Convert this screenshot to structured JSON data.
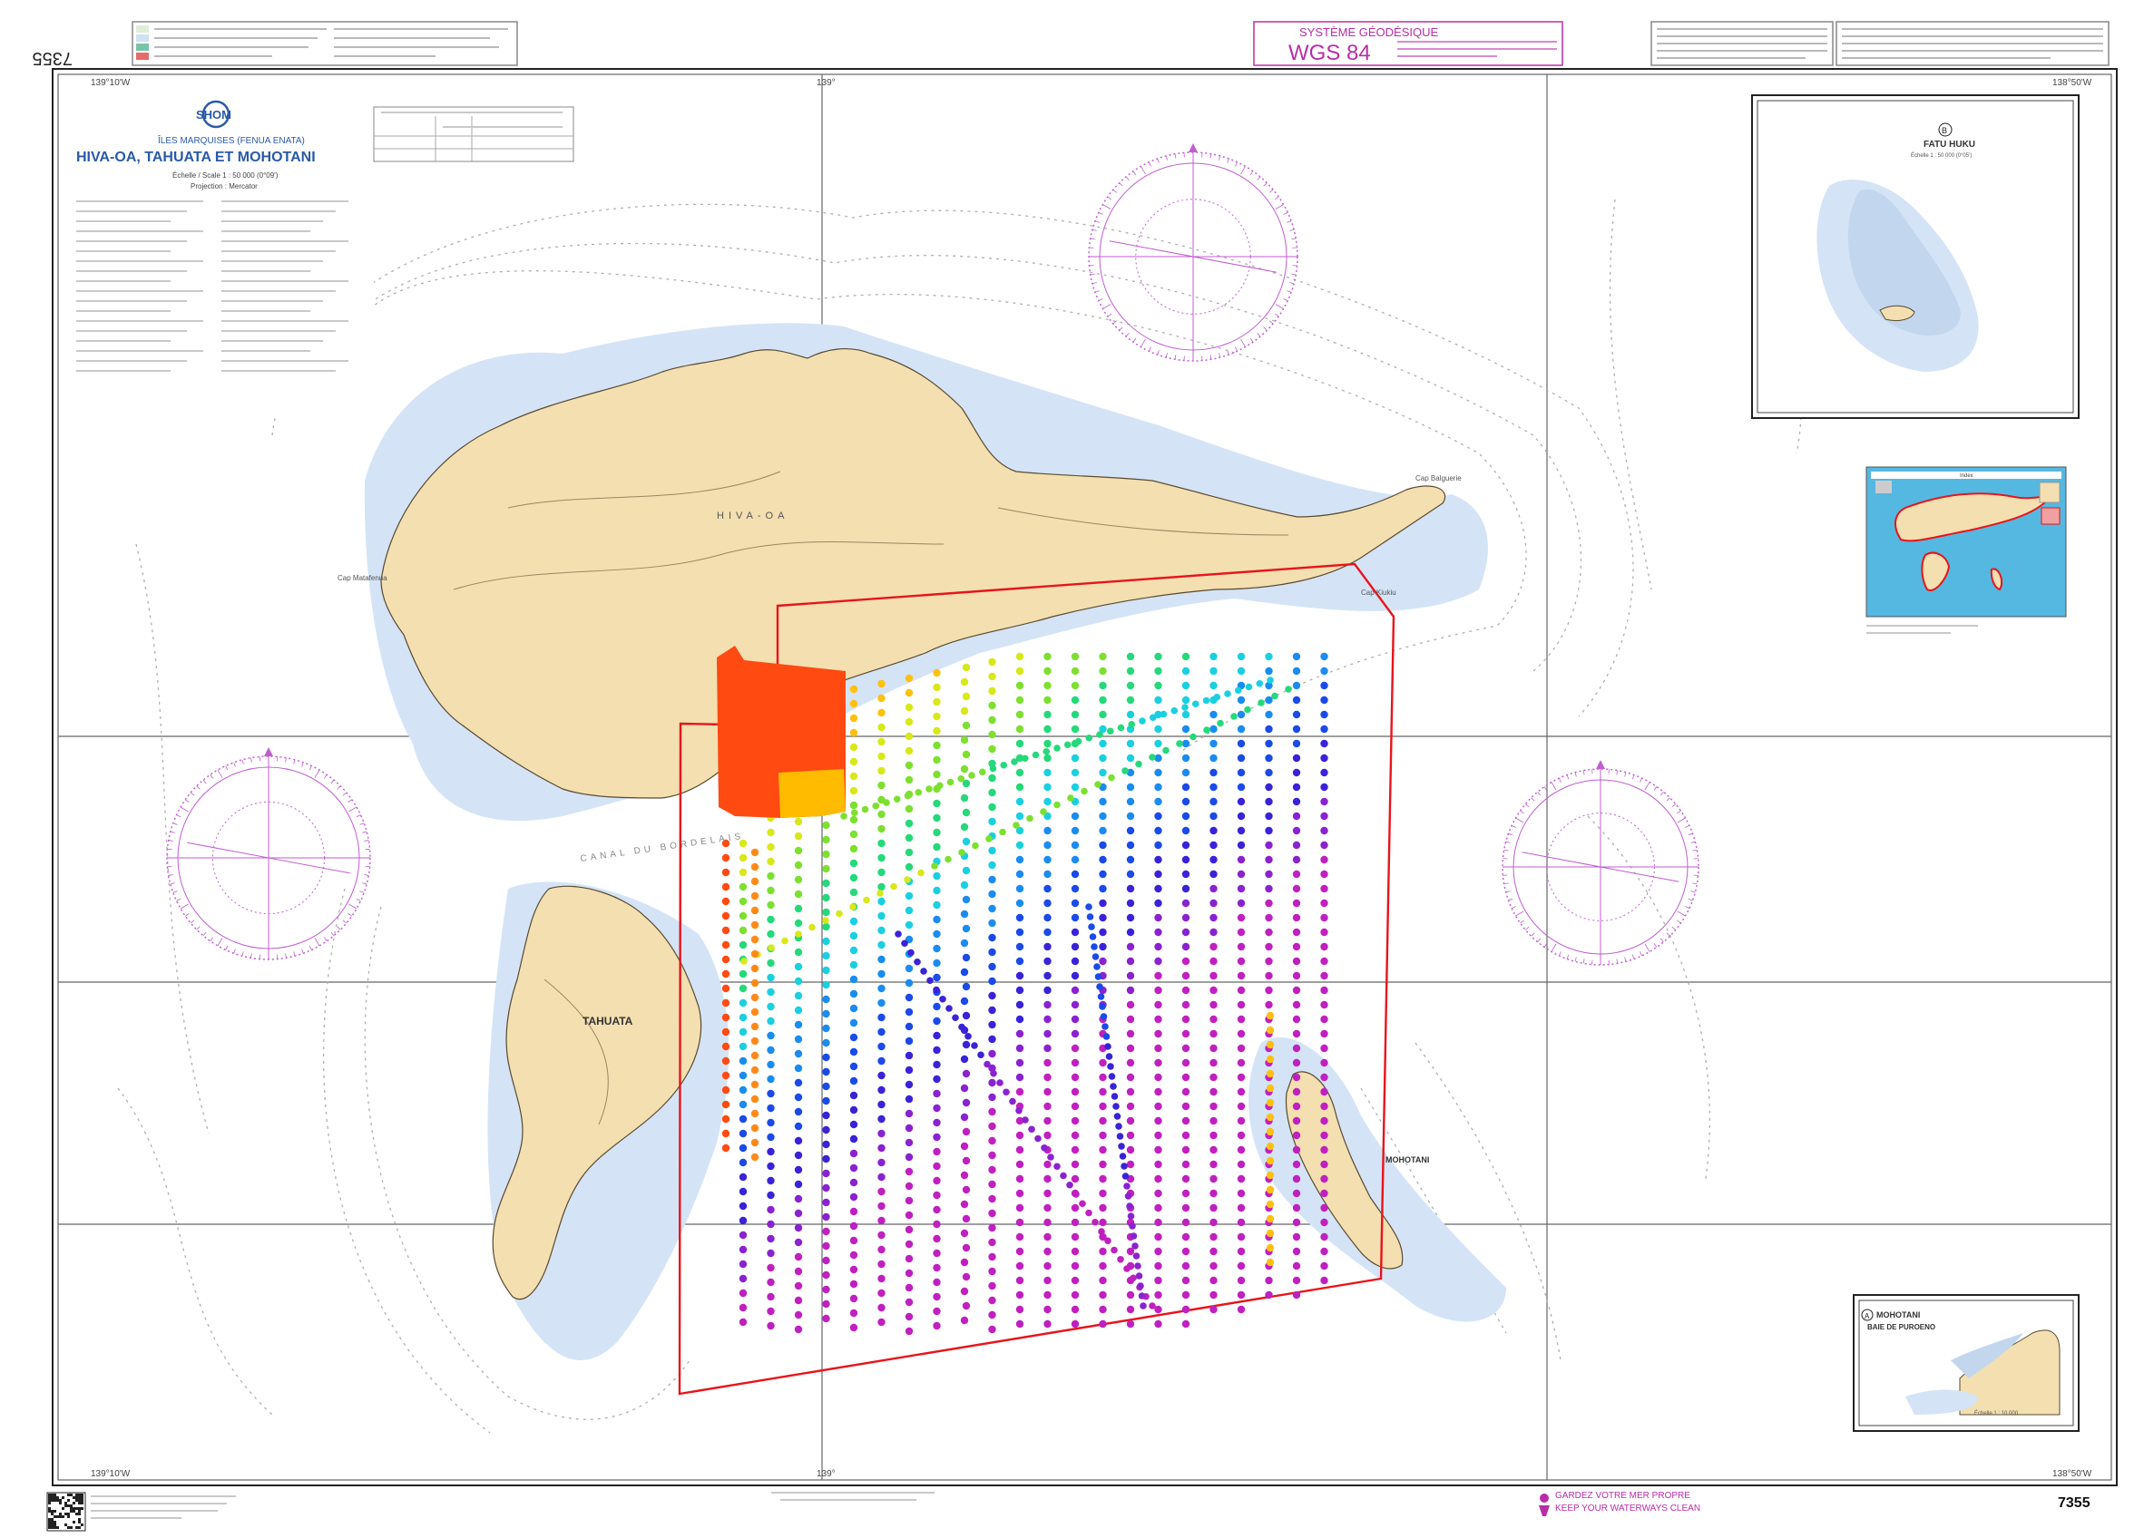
{
  "chart_number": "7355",
  "chart_number_rotated": "7355",
  "producer_logo": "SHOM",
  "region": "ÎLES MARQUISES (FENUA ENATA)",
  "title": "HIVA-OA, TAHUATA ET MOHOTANI",
  "scale_line": "Échelle / Scale 1 : 50 000 (0°09')",
  "projection": "Projection : Mercator",
  "geodetic": {
    "label": "SYSTÈME GÉODÉSIQUE",
    "value": "WGS 84"
  },
  "labels": {
    "hiva_oa": "HIVA-OA",
    "tahuata": "TAHUATA",
    "mohotani": "MOHOTANI",
    "channel": "CANAL DU BORDELAIS",
    "cap_matafenua": "Cap Matafenua",
    "cap_balguerie": "Cap Balguerie",
    "cap_kiukiu": "Cap Kiukiu"
  },
  "longitudes": {
    "left": "139°10'W",
    "mid": "139°",
    "right": "138°50'W"
  },
  "inset_b": {
    "letter": "B",
    "name": "FATU HUKU",
    "scale": "Échelle 1 : 50 000 (0°05')"
  },
  "inset_a": {
    "letter": "A",
    "name": "MOHOTANI",
    "sub": "BAIE DE PUROENO",
    "scale": "Échelle 1 : 10 000"
  },
  "locator_label": "Index",
  "clean_sea": {
    "fr": "GARDEZ VOTRE MER PROPRE",
    "en": "KEEP YOUR WATERWAYS CLEAN"
  },
  "colors": {
    "land": "#f3dfb0",
    "shallow": "#d4e4f6",
    "deep": "#ffffff",
    "survey_outline": "#e8141b",
    "compass": "#c05ed0",
    "blob_main": "#ff4a12",
    "blob_sub": "#ffbb00",
    "title_magenta": "#b82ea8"
  },
  "survey_track_palette": [
    "#ff4a12",
    "#ff8a1a",
    "#ffc010",
    "#d8e81a",
    "#7de030",
    "#25d97a",
    "#1ad0e0",
    "#1a8cf0",
    "#1a4ae8",
    "#3a22d8",
    "#8a22d0",
    "#c020c0"
  ]
}
